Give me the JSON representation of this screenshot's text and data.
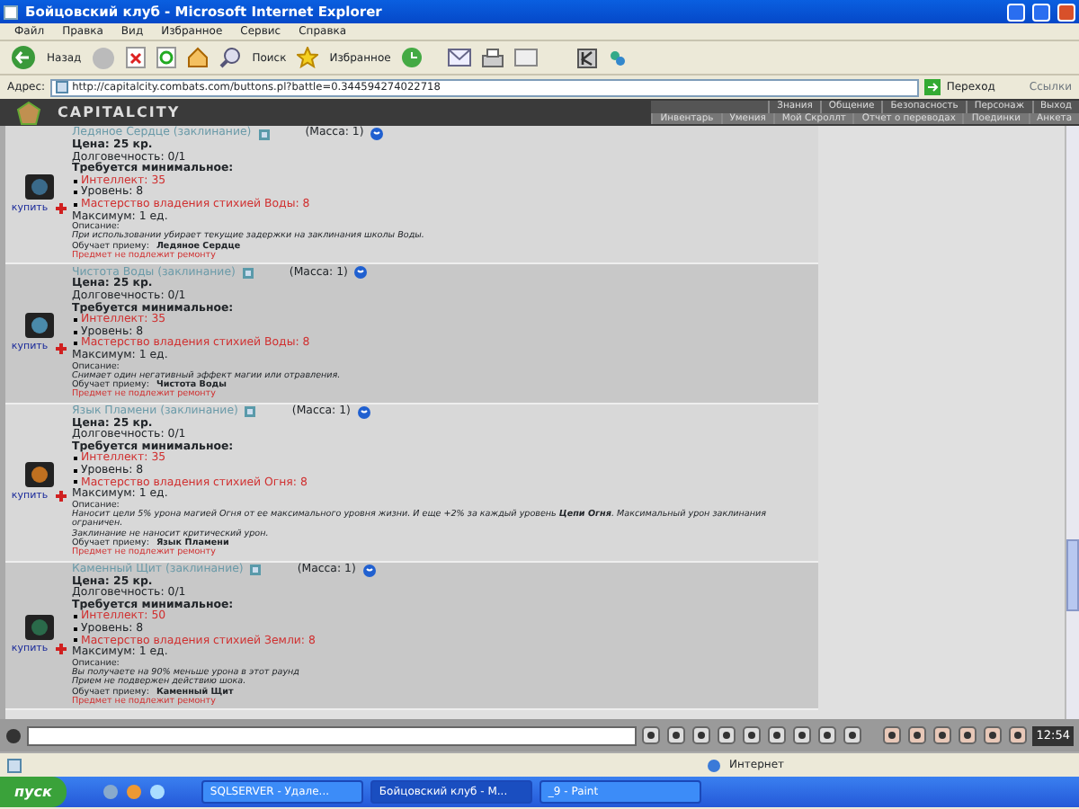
{
  "window": {
    "title": "Бойцовский клуб - Microsoft Internet Explorer"
  },
  "menu": [
    "Файл",
    "Правка",
    "Вид",
    "Избранное",
    "Сервис",
    "Справка"
  ],
  "toolbar": {
    "back": "Назад",
    "search": "Поиск",
    "favorites": "Избранное"
  },
  "address": {
    "label": "Адрес:",
    "value": "http://capitalcity.combats.com/buttons.pl?battle=0.344594274022718",
    "go": "Переход",
    "links": "Ссылки"
  },
  "game": {
    "logo": "CAPITALCITY",
    "nav_top": [
      "Знания",
      "Общение",
      "Безопасность",
      "Персонаж",
      "Выход"
    ],
    "nav_bottom": [
      "Инвентарь",
      "Умения",
      "Мой Скроллт",
      "Отчет о переводах",
      "Поединки",
      "Анкета"
    ]
  },
  "items": [
    {
      "name": "Ледяное Сердце (заклинание)",
      "mass": "(Масса: 1)",
      "price": "Цена: 25 кр.",
      "durability": "Долговечность: 0/1",
      "req_title": "Требуется минимальное:",
      "requirements": [
        {
          "text": "Интеллект: 35",
          "met": false
        },
        {
          "text": "Уровень: 8",
          "met": true
        },
        {
          "text": "Мастерство владения стихией Воды: 8",
          "met": false
        }
      ],
      "maximum": "Максимум: 1 ед.",
      "desc_label": "Описание:",
      "description": [
        "При использовании убирает текущие задержки на заклинания школы Воды."
      ],
      "teaches_label": "Обучает приему:",
      "teaches": "Ледяное Сердце",
      "repair": "Предмет не подлежит ремонту",
      "buy": "купить",
      "color": "#3a6a8a"
    },
    {
      "name": "Чистота Воды (заклинание)",
      "mass": "(Масса: 1)",
      "price": "Цена: 25 кр.",
      "durability": "Долговечность: 0/1",
      "req_title": "Требуется минимальное:",
      "requirements": [
        {
          "text": "Интеллект: 35",
          "met": false
        },
        {
          "text": "Уровень: 8",
          "met": true
        },
        {
          "text": "Мастерство владения стихией Воды: 8",
          "met": false
        }
      ],
      "maximum": "Максимум: 1 ед.",
      "desc_label": "Описание:",
      "description": [
        "Снимает один негативный эффект магии или отравления."
      ],
      "teaches_label": "Обучает приему:",
      "teaches": "Чистота Воды",
      "repair": "Предмет не подлежит ремонту",
      "buy": "купить",
      "color": "#4a8aaa"
    },
    {
      "name": "Язык Пламени (заклинание)",
      "mass": "(Масса: 1)",
      "price": "Цена: 25 кр.",
      "durability": "Долговечность: 0/1",
      "req_title": "Требуется минимальное:",
      "requirements": [
        {
          "text": "Интеллект: 35",
          "met": false
        },
        {
          "text": "Уровень: 8",
          "met": true
        },
        {
          "text": "Мастерство владения стихией Огня: 8",
          "met": false
        }
      ],
      "maximum": "Максимум: 1 ед.",
      "desc_label": "Описание:",
      "description": [
        "Наносит цели 5% урона магией Огня от ее максимального уровня жизни. И еще +2% за каждый уровень **Цепи Огня**. Максимальный урон заклинания ограничен.",
        "Заклинание не наносит критический урон."
      ],
      "teaches_label": "Обучает приему:",
      "teaches": "Язык Пламени",
      "repair": "Предмет не подлежит ремонту",
      "buy": "купить",
      "color": "#c07020"
    },
    {
      "name": "Каменный Щит (заклинание)",
      "mass": "(Масса: 1)",
      "price": "Цена: 25 кр.",
      "durability": "Долговечность: 0/1",
      "req_title": "Требуется минимальное:",
      "requirements": [
        {
          "text": "Интеллект: 50",
          "met": false
        },
        {
          "text": "Уровень: 8",
          "met": true
        },
        {
          "text": "Мастерство владения стихией Земли: 8",
          "met": false
        }
      ],
      "maximum": "Максимум: 1 ед.",
      "desc_label": "Описание:",
      "description": [
        "Вы получаете на 90% меньше урона в этот раунд",
        "Прием не подвержен действию шока."
      ],
      "teaches_label": "Обучает приему:",
      "teaches": "Каменный Щит",
      "repair": "Предмет не подлежит ремонту",
      "buy": "купить",
      "color": "#2a6a4a"
    }
  ],
  "chat": {
    "clock": "12:54"
  },
  "status_bar": {
    "zone": "Интернет"
  },
  "taskbar": {
    "start": "пуск",
    "tasks": [
      {
        "label": "SQLSERVER - Удале...",
        "selected": false
      },
      {
        "label": "Бойцовский клуб - М...",
        "selected": true
      },
      {
        "label": "_9 - Paint",
        "selected": false
      }
    ]
  }
}
